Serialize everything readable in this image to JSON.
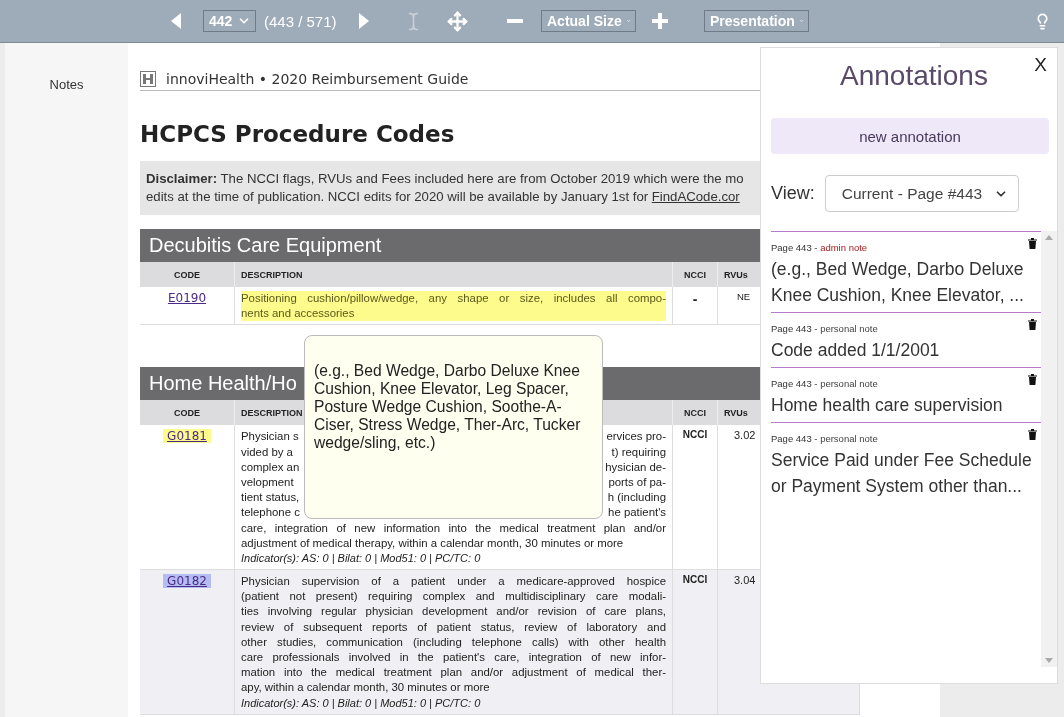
{
  "toolbar": {
    "page_select": "442",
    "page_count": "(443 / 571)",
    "zoom_select": "Actual Size",
    "mode_select": "Presentation"
  },
  "sidebar": {
    "label": "Notes"
  },
  "document": {
    "header": "innoviHealth • 2020 Reimbursement Guide",
    "title": "HCPCS Procedure Codes",
    "disclaimer": {
      "text": "**Disclaimer:** The NCCI flags, RVUs and Fees included here are from October 2019 which were the mo\nedits at the time of publication. NCCI edits for 2020 will be available by January 1st for ",
      "link": "FindACode.cor"
    },
    "sections": [
      {
        "title": "Decubitis Care Equipment",
        "columns": [
          "CODE",
          "DESCRIPTION",
          "NCCI",
          "RVUs"
        ],
        "rows": [
          {
            "kind": "text",
            "code": {
              "text": "E0190"
            },
            "description": {
              "text": "Positioning cushion/pillow/wedge, any shape or size, includes all compo-\nnents and accessories",
              "color": "#fdfb8c"
            },
            "ncci": "-",
            "rvus": "NE",
            "shaded": false
          }
        ]
      },
      {
        "title": "Home Health/Ho",
        "columns": [
          "CODE",
          "DESCRIPTION",
          "NCCI",
          "RVUs"
        ],
        "rows": [
          {
            "kind": "partly_covered",
            "code": {
              "text": "G0181",
              "color": "#fdfb8c"
            },
            "lines": [
              {
                "start": "Physician s",
                "end": "ervices pro-"
              },
              {
                "start": "vided by a",
                "end": "t) requiring"
              },
              {
                "start": "complex an",
                "end": "hysician de-"
              },
              {
                "start": "velopment",
                "end": "ports of pa-"
              },
              {
                "start": "tient status,",
                "end": "h (including"
              },
              {
                "start": "telephone c",
                "end": "he patient's"
              }
            ],
            "description": {
              "text": "care, integration of new information into the medical treatment plan and/or\nadjustment of medical therapy, within a calendar month, 30 minutes or more"
            },
            "indicators": "Indicator(s): AS: 0 | Bilat: 0 | Mod51: 0 | PC/TC: 0",
            "ncci": "NCCI",
            "rvus": "3.02",
            "shaded": false
          },
          {
            "kind": "text",
            "code": {
              "text": "G0182",
              "color": "#b4bcf2"
            },
            "description": {
              "text": "Physician supervision of a patient under a medicare-approved hospice\n(patient not present) requiring complex and multidisciplinary care modali-\nties involving regular physician development and/or revision of care plans,\nreview of subsequent reports of patient status, review of laboratory and\nother studies, communication (including telephone calls) with other health\ncare professionals involved in the patient's care, integration of new infor-\nmation into the medical treatment plan and/or adjustment of medical ther-\napy, within a calendar month, 30 minutes or more"
            },
            "indicators": "Indicator(s): AS: 0 | Bilat: 0 | Mod51: 0 | PC/TC: 0",
            "ncci": "NCCI",
            "rvus": "3.04",
            "shaded": true
          }
        ]
      }
    ]
  },
  "tooltip": {
    "text": "(e.g., Bed Wedge, Darbo Deluxe Knee Cushion, Knee Elevator, Leg Spacer, Posture Wedge Cushion, Soothe-A-Ciser, Stress Wedge, Ther-Arc, Tucker wedge/sling, etc.)"
  },
  "annotations": {
    "title": "Annotations",
    "close": "X",
    "new_button": "new annotation",
    "view_label": "View:",
    "view_select": "Current - Page #443",
    "notes": [
      {
        "kind": "admin",
        "page": "Page 443 -",
        "type": "admin note",
        "text": "(e.g., Bed Wedge, Darbo Deluxe Knee Cushion, Knee Elevator, ..."
      },
      {
        "kind": "personal",
        "page": "Page 443 -",
        "type": "personal note",
        "text": "Code added 1/1/2001"
      },
      {
        "kind": "personal",
        "page": "Page 443 -",
        "type": "personal note",
        "text": "Home health care supervision"
      },
      {
        "kind": "personal",
        "page": "Page 443 -",
        "type": "personal note",
        "text": "Service Paid under Fee Schedule or Payment System other than..."
      }
    ]
  }
}
